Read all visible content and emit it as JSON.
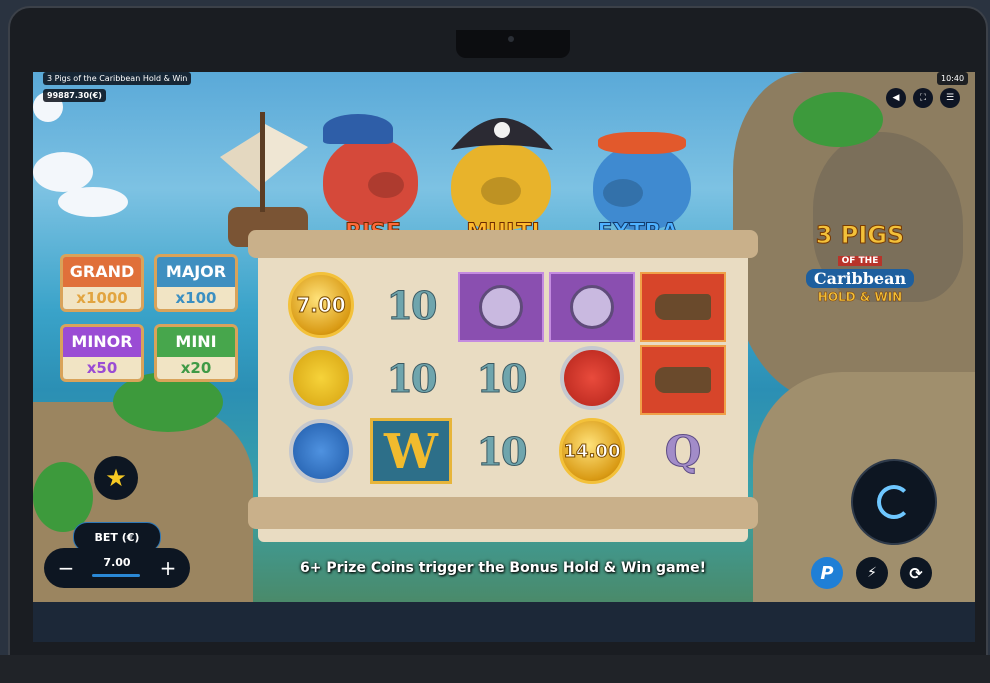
{
  "game": {
    "title": "3 Pigs of the Caribbean Hold & Win",
    "balance": "99887.30(€)",
    "clock": "10:40"
  },
  "top_controls": [
    {
      "name": "sound-icon",
      "glyph": "◀"
    },
    {
      "name": "fullscreen-icon",
      "glyph": "⛶"
    },
    {
      "name": "menu-icon",
      "glyph": "☰"
    }
  ],
  "pigs": {
    "rise": "RISE",
    "multi": "MULTI",
    "extra": "EXTRA"
  },
  "jackpots": {
    "grand": {
      "name": "GRAND",
      "value": "x1000",
      "color": "#e0703a"
    },
    "major": {
      "name": "MAJOR",
      "value": "x100",
      "color": "#3f8fc0"
    },
    "minor": {
      "name": "MINOR",
      "value": "x50",
      "color": "#9a4cd4"
    },
    "mini": {
      "name": "MINI",
      "value": "x20",
      "color": "#47a64c"
    }
  },
  "reels": {
    "row1": [
      "7.00",
      "10",
      "compass",
      "compass",
      "cannon"
    ],
    "row2": [
      "pig-gold",
      "10",
      "10",
      "pig-red",
      "cannon"
    ],
    "row3": [
      "pig-blue",
      "W",
      "10",
      "14.00",
      "Q"
    ]
  },
  "logo": {
    "line1": "3 PIGS",
    "line2": "OF THE",
    "line3": "Caribbean",
    "line4": "HOLD & WIN"
  },
  "bet": {
    "label": "BET (€)",
    "value": "7.00",
    "minus": "−",
    "plus": "+"
  },
  "message": "6+ Prize Coins trigger the Bonus Hold & Win game!",
  "bottom_buttons": {
    "provider": "P",
    "turbo": "⚡",
    "autoplay": "⟳"
  },
  "colors": {
    "gold": "#f3c13a",
    "accent": "#6ec7ff"
  }
}
